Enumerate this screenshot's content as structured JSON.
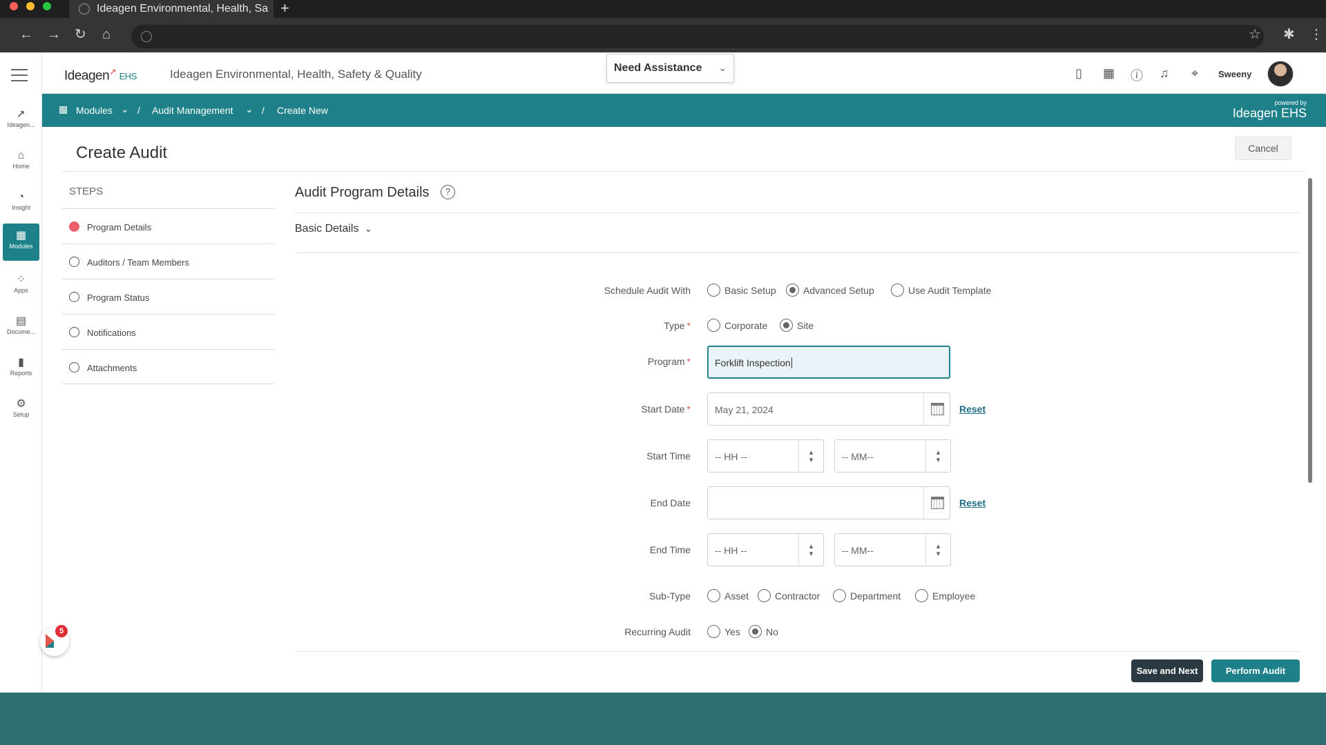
{
  "browser": {
    "tab_title": "Ideagen Environmental, Health, Sa",
    "new_tab": "+",
    "icons": [
      "back-arrow-icon",
      "forward-arrow-icon",
      "reload-icon",
      "home-icon",
      "star-icon",
      "extensions-icon",
      "kebab-menu-icon"
    ]
  },
  "rail": {
    "items": [
      {
        "label": "Ideagen...",
        "icon": "ideagen-icon"
      },
      {
        "label": "Home",
        "icon": "home-icon"
      },
      {
        "label": "Insight",
        "icon": "insight-icon"
      },
      {
        "label": "Modules",
        "icon": "modules-icon",
        "active": true
      },
      {
        "label": "Apps",
        "icon": "apps-icon"
      },
      {
        "label": "Docume...",
        "icon": "document-icon"
      },
      {
        "label": "Reports",
        "icon": "reports-icon"
      },
      {
        "label": "Setup",
        "icon": "gear-icon"
      }
    ]
  },
  "header": {
    "logo_text": "Ideagen",
    "logo_suffix": "EHS",
    "app_title": "Ideagen Environmental, Health, Safety & Quality",
    "assistance_label": "Need Assistance",
    "user_name": "Sweeny"
  },
  "breadcrumb": {
    "modules": "Modules",
    "audit_management": "Audit Management",
    "create_new": "Create New",
    "separator": "/",
    "powered_by": "powered by",
    "powered_logo": "Ideagen EHS"
  },
  "page": {
    "title": "Create Audit",
    "cancel_label": "Cancel"
  },
  "steps": {
    "title": "STEPS",
    "items": [
      {
        "label": "Program Details",
        "active": true
      },
      {
        "label": "Auditors / Team Members"
      },
      {
        "label": "Program Status"
      },
      {
        "label": "Notifications"
      },
      {
        "label": "Attachments"
      }
    ]
  },
  "form": {
    "section_title": "Audit Program Details",
    "help": "?",
    "basic_details": "Basic Details",
    "schedule": {
      "label": "Schedule Audit With",
      "options": [
        "Basic Setup",
        "Advanced Setup",
        "Use Audit Template"
      ],
      "selected": "Advanced Setup"
    },
    "type": {
      "label": "Type",
      "options": [
        "Corporate",
        "Site"
      ],
      "selected": "Site"
    },
    "program": {
      "label": "Program",
      "value": "Forklift Inspection"
    },
    "start_date": {
      "label": "Start Date",
      "value": "May 21, 2024",
      "reset": "Reset"
    },
    "start_time": {
      "label": "Start Time",
      "hh_placeholder": "-- HH --",
      "mm_placeholder": "-- MM--"
    },
    "end_date": {
      "label": "End Date",
      "value": "",
      "reset": "Reset"
    },
    "end_time": {
      "label": "End Time",
      "hh_placeholder": "-- HH --",
      "mm_placeholder": "-- MM--"
    },
    "sub_type": {
      "label": "Sub-Type",
      "options": [
        "Asset",
        "Contractor",
        "Department",
        "Employee"
      ],
      "selected": ""
    },
    "recurring": {
      "label": "Recurring Audit",
      "options": [
        "Yes",
        "No"
      ],
      "selected": "No"
    },
    "required_mark": "*"
  },
  "actions": {
    "save_next": "Save and Next",
    "perform": "Perform Audit"
  },
  "fab": {
    "badge": "5"
  },
  "colors": {
    "accent": "#1e8189",
    "active_step": "#ec5f6a",
    "dark_button": "#2b3a42",
    "badge": "#e02d36"
  }
}
